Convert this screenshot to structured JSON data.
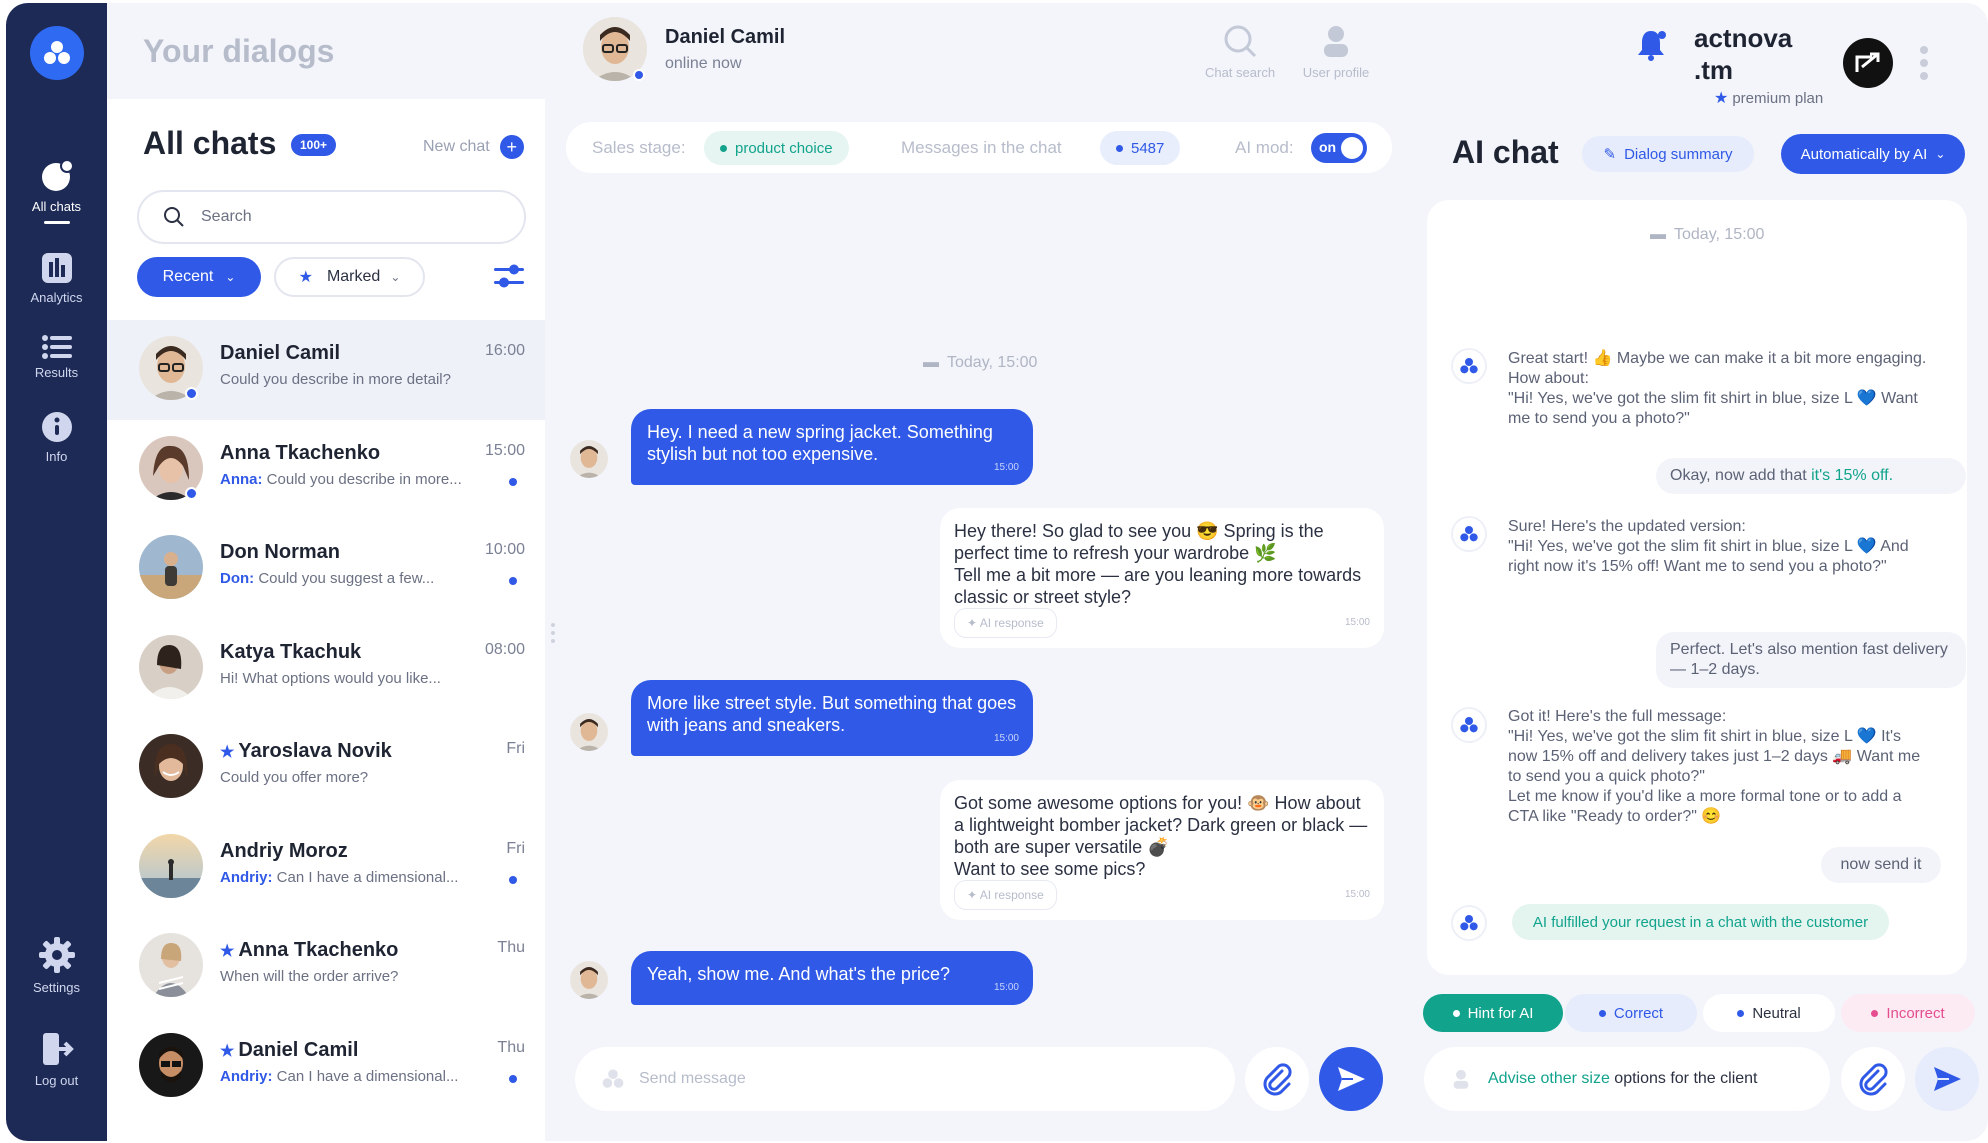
{
  "header": {
    "page_title": "Your dialogs",
    "contact_name": "Daniel Camil",
    "contact_status": "online now",
    "tools": [
      {
        "label": "Chat search",
        "icon": "search-icon"
      },
      {
        "label": "User profile",
        "icon": "user-icon"
      }
    ],
    "brand_line1": "actnova",
    "brand_line2": ".tm",
    "plan": "premium plan"
  },
  "nav": {
    "items": [
      {
        "label": "All chats",
        "icon": "chat-bubble-icon",
        "active": true
      },
      {
        "label": "Analytics",
        "icon": "analytics-icon"
      },
      {
        "label": "Results",
        "icon": "list-icon"
      },
      {
        "label": "Info",
        "icon": "info-icon"
      },
      {
        "label": "Settings",
        "icon": "gear-icon"
      },
      {
        "label": "Log out",
        "icon": "logout-icon"
      }
    ]
  },
  "chats": {
    "title": "All chats",
    "count_badge": "100+",
    "new_chat": "New chat",
    "search_placeholder": "Search",
    "filter_recent": "Recent",
    "filter_marked": "Marked",
    "items": [
      {
        "name": "Daniel Camil",
        "prefix": "",
        "preview": "Could you describe in more detail?",
        "time": "16:00",
        "starred": false,
        "unread": false,
        "online": true
      },
      {
        "name": "Anna Tkachenko",
        "prefix": "Anna:",
        "preview": "Could you describe in more...",
        "time": "15:00",
        "starred": false,
        "unread": true,
        "online": true
      },
      {
        "name": "Don Norman",
        "prefix": "Don:",
        "preview": "Could you suggest a few...",
        "time": "10:00",
        "starred": false,
        "unread": true,
        "online": false
      },
      {
        "name": "Katya Tkachuk",
        "prefix": "",
        "preview": "Hi! What options would you like...",
        "time": "08:00",
        "starred": false,
        "unread": false,
        "online": false
      },
      {
        "name": "Yaroslava Novik",
        "prefix": "",
        "preview": "Could you offer more?",
        "time": "Fri",
        "starred": true,
        "unread": false,
        "online": false
      },
      {
        "name": "Andriy Moroz",
        "prefix": "Andriy:",
        "preview": "Can I have a dimensional...",
        "time": "Fri",
        "starred": false,
        "unread": true,
        "online": false
      },
      {
        "name": "Anna Tkachenko",
        "prefix": "",
        "preview": "When will the order arrive?",
        "time": "Thu",
        "starred": true,
        "unread": false,
        "online": false
      },
      {
        "name": "Daniel Camil",
        "prefix": "Andriy:",
        "preview": "Can I have a dimensional...",
        "time": "Thu",
        "starred": true,
        "unread": true,
        "online": false
      }
    ]
  },
  "conversation": {
    "stage_label": "Sales stage:",
    "stage_value": "product choice",
    "messages_label": "Messages in the chat",
    "messages_count": "5487",
    "ai_mod_label": "AI mod:",
    "ai_mod_value": "on",
    "date": "Today, 15:00",
    "messages": [
      {
        "side": "customer",
        "text": "Hey. I need a new spring jacket. Something stylish but not too expensive.",
        "time": "15:00"
      },
      {
        "side": "ai",
        "text": "Hey there! So glad to see you 😎 Spring is the perfect time to refresh your wardrobe 🌿\nTell me a bit more — are you leaning more towards classic or street style?",
        "time": "15:00",
        "tag": "AI response"
      },
      {
        "side": "customer",
        "text": "More like street style. But something that goes with jeans and sneakers.",
        "time": "15:00"
      },
      {
        "side": "ai",
        "text": "Got some awesome options for you! 🐵 How about a lightweight bomber jacket? Dark green or black — both are super versatile 💣\nWant to see some pics?",
        "time": "15:00",
        "tag": "AI response"
      },
      {
        "side": "customer",
        "text": "Yeah, show me. And what's the price?",
        "time": "15:00"
      }
    ],
    "input_placeholder": "Send message"
  },
  "ai_chat": {
    "title": "AI chat",
    "summary_button": "Dialog summary",
    "mode_button": "Automatically by AI",
    "date": "Today, 15:00",
    "bot_1": "Great start! 👍 Maybe we can make it a bit more engaging. How about:\n\"Hi! Yes, we've got the slim fit shirt in blue, size L 💙 Want me to send you a photo?\"",
    "user_1_a": "Okay, now add that ",
    "user_1_b": "it's 15% off.",
    "bot_2": "Sure! Here's the updated version:\n\"Hi! Yes, we've got the slim fit shirt in blue, size L 💙 And right now it's 15% off! Want me to send you a photo?\"",
    "user_2": "Perfect. Let's also mention fast delivery — 1–2 days.",
    "bot_3": "Got it! Here's the full message:\n\"Hi! Yes, we've got the slim fit shirt in blue, size L 💙 It's now 15% off and delivery takes just 1–2 days 🚚 Want me to send you a quick photo?\"\nLet me know if you'd like a more formal tone or to add a CTA like \"Ready to order?\" 😊",
    "user_3": "now send it",
    "fulfilled": "AI fulfilled your request in a chat with the customer",
    "tags": [
      "Hint for AI",
      "Correct",
      "Neutral",
      "Incorrect"
    ],
    "hint_a": "Advise other size",
    "hint_b": " options for the client"
  },
  "colors": {
    "accent": "#2f59e6",
    "nav_bg": "#1d2a55",
    "teal": "#12a38c",
    "pink": "#e44d8f"
  }
}
